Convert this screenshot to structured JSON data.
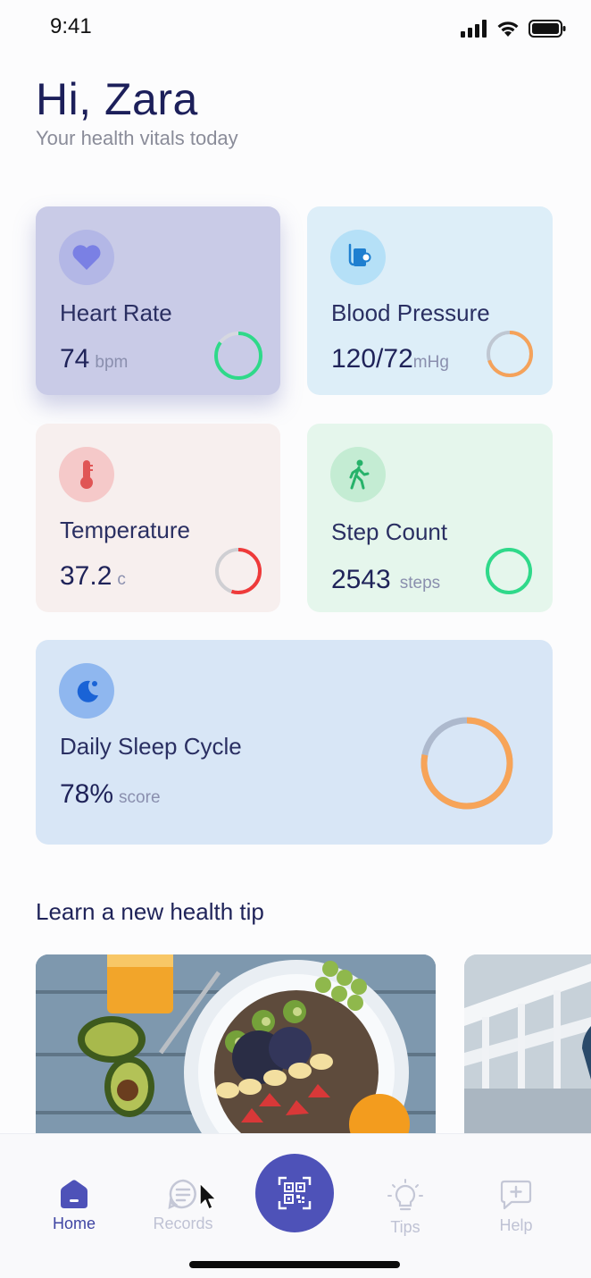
{
  "status_bar": {
    "time": "9:41",
    "icons": [
      "cellular-signal-icon",
      "wifi-icon",
      "battery-icon"
    ]
  },
  "header": {
    "greeting": "Hi, Zara",
    "subtitle": "Your health vitals today"
  },
  "vitals": {
    "heart_rate": {
      "icon": "heart-icon",
      "title": "Heart Rate",
      "value": "74",
      "unit": "bpm",
      "color": "#2fd98a",
      "progress": 0.85
    },
    "blood_pressure": {
      "icon": "blood-pressure-icon",
      "title": "Blood Pressure",
      "value": "120/72",
      "unit": "mHg",
      "color": "#f5a25a",
      "progress": 0.7
    },
    "temperature": {
      "icon": "thermometer-icon",
      "title": "Temperature",
      "value": "37.2",
      "unit": "c",
      "color": "#ef3a3a",
      "progress": 0.55
    },
    "step_count": {
      "icon": "walking-icon",
      "title": "Step Count",
      "value": "2543",
      "unit": "steps",
      "color": "#2fd98a",
      "progress": 1.0
    },
    "sleep": {
      "icon": "moon-icon",
      "title": "Daily Sleep Cycle",
      "value": "78%",
      "unit": "score",
      "color": "#f7a458",
      "progress": 0.78
    }
  },
  "tips": {
    "section_title": "Learn a new health tip"
  },
  "bottom_nav": {
    "home": {
      "label": "Home",
      "icon": "home-icon"
    },
    "records": {
      "label": "Records",
      "icon": "records-icon"
    },
    "scan": {
      "icon": "qr-code-icon"
    },
    "tips": {
      "label": "Tips",
      "icon": "lightbulb-icon"
    },
    "help": {
      "label": "Help",
      "icon": "help-chat-icon"
    }
  },
  "colors": {
    "accent": "#4e52b8",
    "title": "#1c1f5a"
  }
}
